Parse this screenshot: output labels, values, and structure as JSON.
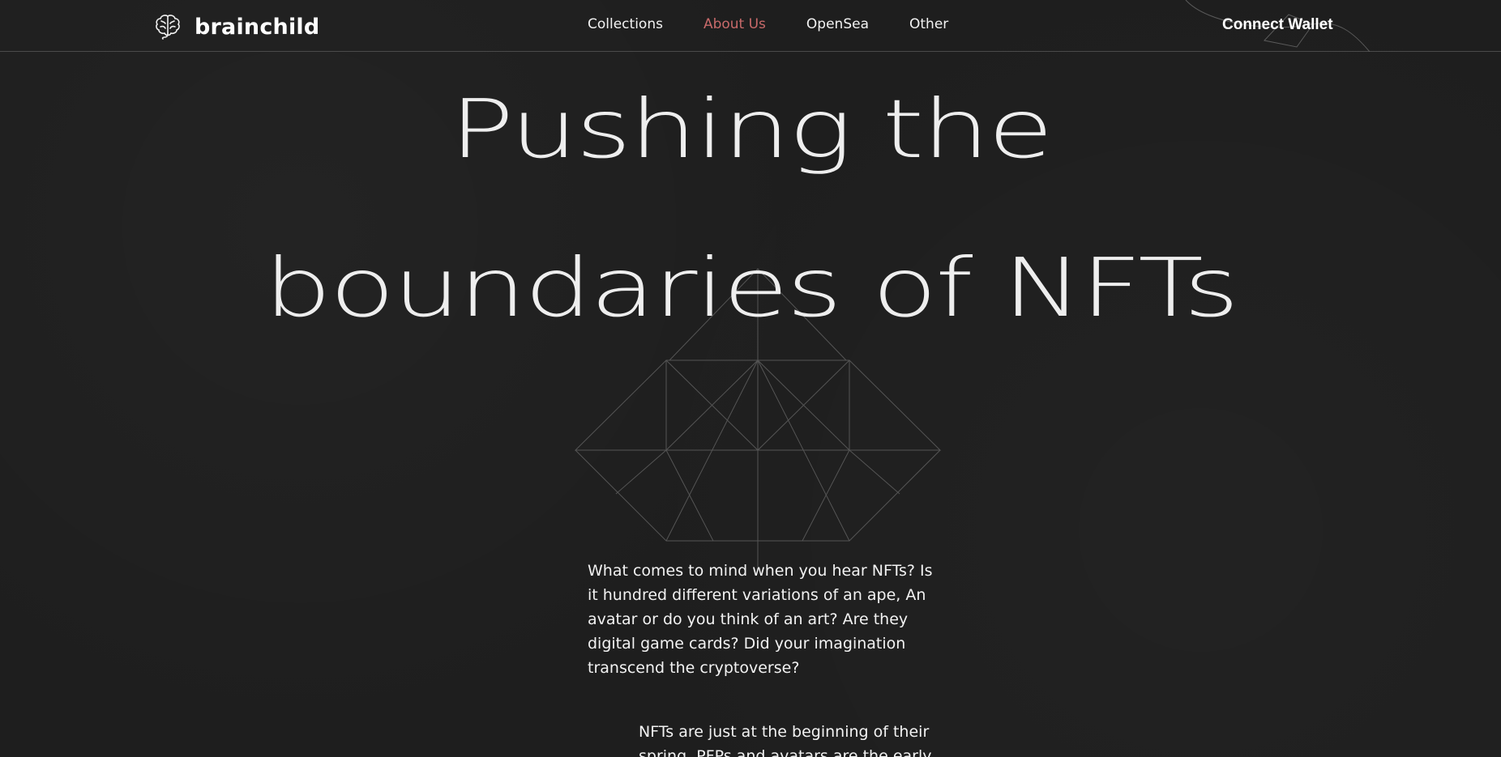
{
  "header": {
    "brand": "brainchild",
    "nav": [
      {
        "label": "Collections"
      },
      {
        "label": "About Us"
      },
      {
        "label": "OpenSea"
      },
      {
        "label": "Other"
      }
    ],
    "connect_label": "Connect Wallet",
    "active_color": "#c86a6a"
  },
  "hero": {
    "line1": "Pushing the",
    "line2": "boundaries of NFTs"
  },
  "intro": {
    "paragraph1": "What comes to mind when you hear NFTs? Is it hundred different variations of an ape, An avatar or do you think of an art? Are they digital game cards? Did your imagination transcend the cryptoverse?",
    "paragraph2": "NFTs are just at the beginning of their spring. PFPs and avatars are the early"
  },
  "icons": {
    "logo": "brain-icon"
  }
}
